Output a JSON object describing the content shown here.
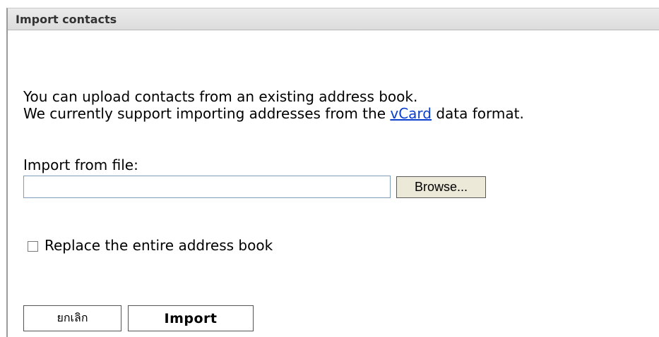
{
  "panel": {
    "title": "Import contacts"
  },
  "intro": {
    "line1": "You can upload contacts from an existing address book.",
    "line2_before": "We currently support importing addresses from the ",
    "line2_link": "vCard",
    "line2_after": " data format."
  },
  "file": {
    "label": "Import from file:",
    "value": "",
    "browse_label": "Browse..."
  },
  "replace": {
    "checked": false,
    "label": "Replace the entire address book"
  },
  "actions": {
    "cancel_label": "ยกเลิก",
    "import_label": "Import"
  }
}
